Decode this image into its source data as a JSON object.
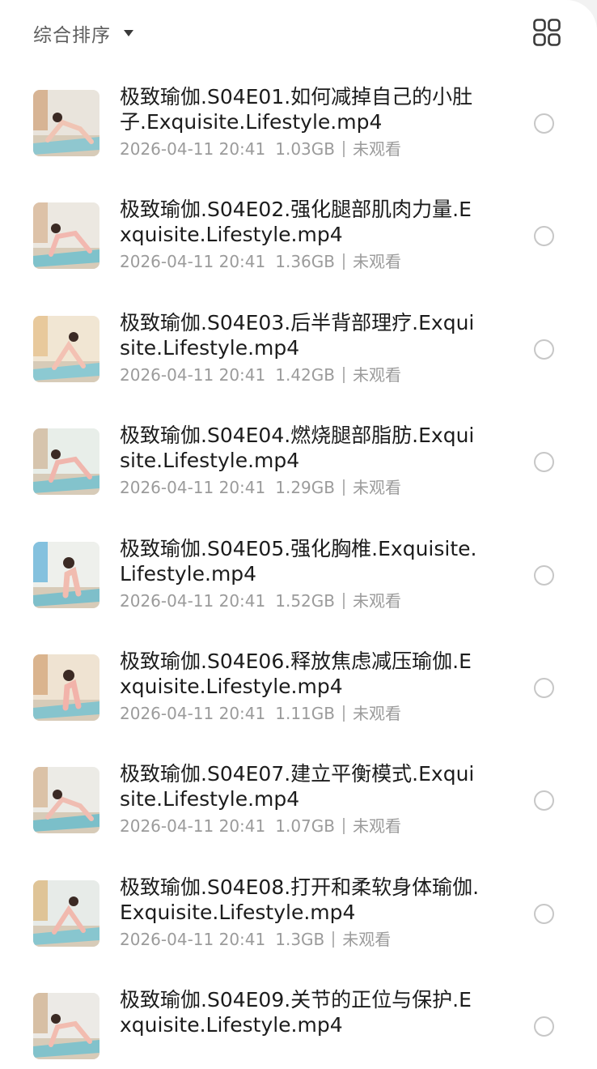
{
  "toolbar": {
    "sort_label": "综合排序",
    "sort_icon": "caret-down-icon",
    "view_toggle_icon": "grid-view-icon"
  },
  "files": [
    {
      "title": "极致瑜伽.S04E01.如何减掉自己的小肚子.Exquisite.Lifestyle.mp4",
      "date": "2026-04-11 20:41",
      "size": "1.03GB",
      "status": "未观看",
      "selected": false
    },
    {
      "title": "极致瑜伽.S04E02.强化腿部肌肉力量.Exquisite.Lifestyle.mp4",
      "date": "2026-04-11 20:41",
      "size": "1.36GB",
      "status": "未观看",
      "selected": false
    },
    {
      "title": "极致瑜伽.S04E03.后半背部理疗.Exquisite.Lifestyle.mp4",
      "date": "2026-04-11 20:41",
      "size": "1.42GB",
      "status": "未观看",
      "selected": false
    },
    {
      "title": "极致瑜伽.S04E04.燃烧腿部脂肪.Exquisite.Lifestyle.mp4",
      "date": "2026-04-11 20:41",
      "size": "1.29GB",
      "status": "未观看",
      "selected": false
    },
    {
      "title": "极致瑜伽.S04E05.强化胸椎.Exquisite.Lifestyle.mp4",
      "date": "2026-04-11 20:41",
      "size": "1.52GB",
      "status": "未观看",
      "selected": false
    },
    {
      "title": "极致瑜伽.S04E06.释放焦虑减压瑜伽.Exquisite.Lifestyle.mp4",
      "date": "2026-04-11 20:41",
      "size": "1.11GB",
      "status": "未观看",
      "selected": false
    },
    {
      "title": "极致瑜伽.S04E07.建立平衡模式.Exquisite.Lifestyle.mp4",
      "date": "2026-04-11 20:41",
      "size": "1.07GB",
      "status": "未观看",
      "selected": false
    },
    {
      "title": "极致瑜伽.S04E08.打开和柔软身体瑜伽.Exquisite.Lifestyle.mp4",
      "date": "2026-04-11 20:41",
      "size": "1.3GB",
      "status": "未观看",
      "selected": false
    },
    {
      "title": "极致瑜伽.S04E09.关节的正位与保护.Exquisite.Lifestyle.mp4",
      "date": "",
      "size": "",
      "status": "",
      "selected": false
    }
  ]
}
